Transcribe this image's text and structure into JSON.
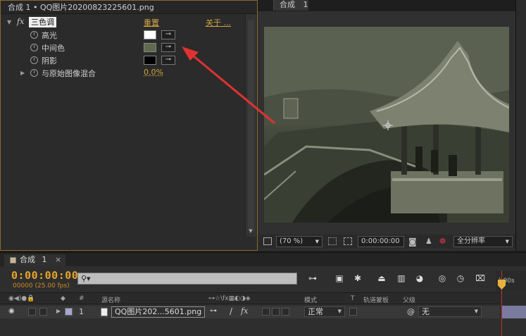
{
  "effect_panel": {
    "header": "合成 1 • QQ图片20200823225601.png",
    "effect": {
      "badge": "fx",
      "name": "三色调",
      "reset_label": "重置",
      "about_label": "关于 ..."
    },
    "params": [
      {
        "label": "高光",
        "color": "#ffffff"
      },
      {
        "label": "中间色",
        "color": "#5f6a4f"
      },
      {
        "label": "阴影",
        "color": "#000000"
      }
    ],
    "blend": {
      "label": "与原始图像混合",
      "value": "0.0%"
    }
  },
  "composition": {
    "tab_label": "合成",
    "tab_number": "1",
    "zoom": "(70 %)",
    "timecode": "0:00:00:00",
    "resolution": "全分辨率"
  },
  "timeline": {
    "tab_label": "合成",
    "tab_number": "1",
    "timecode": "0:00:00:00",
    "fps": "00000 (25.00 fps)",
    "ruler_label": "):00s",
    "columns": {
      "number": "#",
      "source_name": "源名称",
      "mode": "模式",
      "trkmat_t": "T",
      "trkmat": "轨道蒙板",
      "parent": "父级"
    },
    "layer": {
      "number": "1",
      "name": "QQ图片202...5601.png",
      "mode": "正常",
      "parent": "无"
    }
  },
  "colors": {
    "accent_gold": "#d1a63f",
    "timecode_orange": "#e7a52a",
    "annotation_red": "#e03232",
    "panel_border": "#8a6a2c"
  }
}
